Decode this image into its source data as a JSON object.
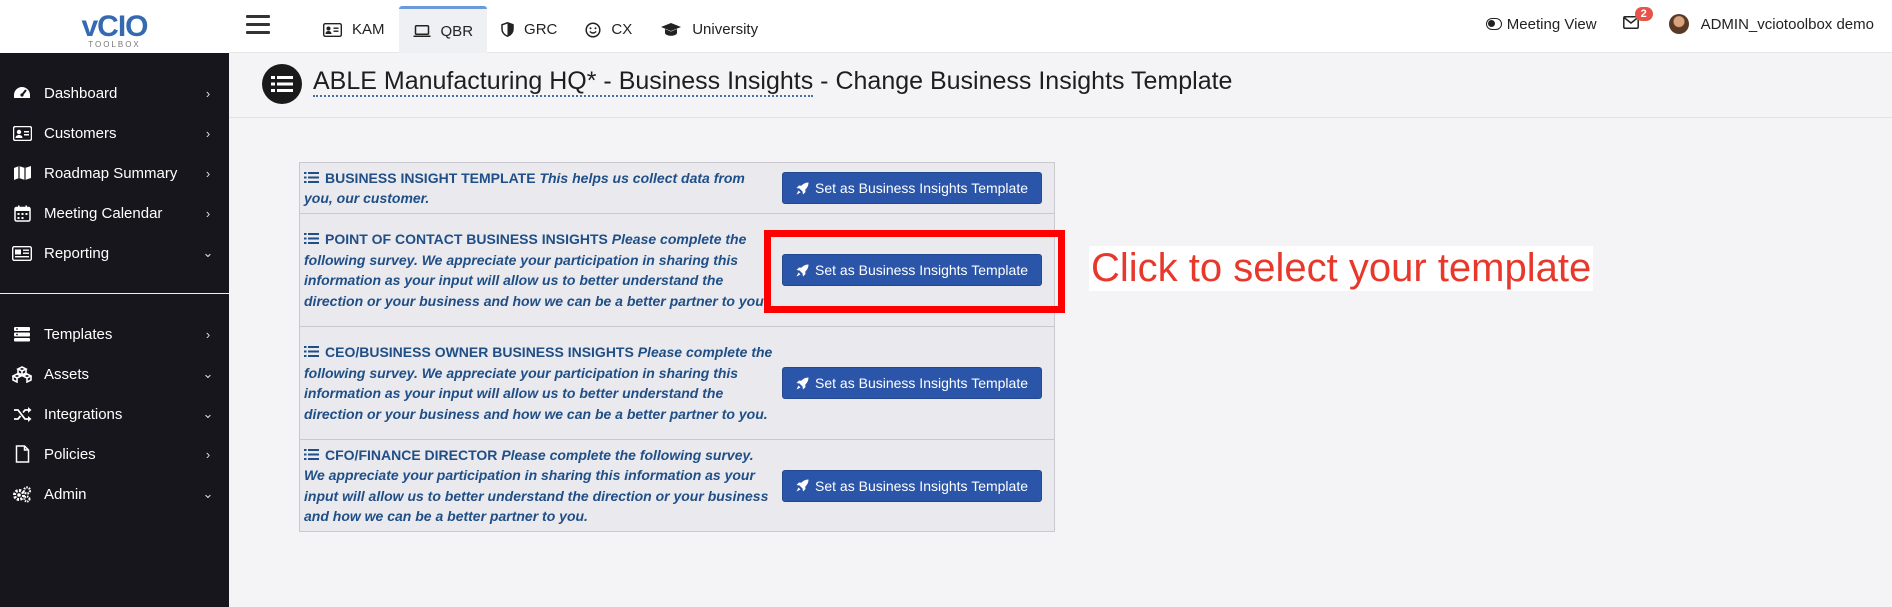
{
  "logo": {
    "main": "vCIO",
    "sub": "TOOLBOX"
  },
  "sidebar": {
    "items": [
      {
        "label": "Dashboard",
        "icon": "dashboard-icon",
        "caret": "›"
      },
      {
        "label": "Customers",
        "icon": "address-card-icon",
        "caret": "›"
      },
      {
        "label": "Roadmap Summary",
        "icon": "map-icon",
        "caret": "›"
      },
      {
        "label": "Meeting Calendar",
        "icon": "calendar-icon",
        "caret": "›"
      },
      {
        "label": "Reporting",
        "icon": "reporting-icon",
        "caret": "⌄"
      }
    ],
    "items2": [
      {
        "label": "Templates",
        "icon": "templates-icon",
        "caret": "›"
      },
      {
        "label": "Assets",
        "icon": "assets-icon",
        "caret": "⌄"
      },
      {
        "label": "Integrations",
        "icon": "shuffle-icon",
        "caret": "⌄"
      },
      {
        "label": "Policies",
        "icon": "file-icon",
        "caret": "›"
      },
      {
        "label": "Admin",
        "icon": "gears-icon",
        "caret": "⌄"
      }
    ]
  },
  "topbar": {
    "tabs": [
      {
        "label": "KAM",
        "icon": "id-card-icon",
        "active": false
      },
      {
        "label": "QBR",
        "icon": "laptop-icon",
        "active": true
      },
      {
        "label": "GRC",
        "icon": "shield-icon",
        "active": false
      },
      {
        "label": "CX",
        "icon": "smile-icon",
        "active": false
      },
      {
        "label": "University",
        "icon": "graduation-cap-icon",
        "active": false
      }
    ],
    "meeting_view": "Meeting View",
    "mail_badge": "2",
    "user_name": "ADMIN_vciotoolbox demo"
  },
  "page": {
    "title_link": "ABLE Manufacturing HQ* - Business Insights",
    "title_rest": " - Change Business Insights Template"
  },
  "templates": [
    {
      "name": "BUSINESS INSIGHT TEMPLATE",
      "description": "This helps us collect data from you, our customer.",
      "button": "Set as Business Insights Template"
    },
    {
      "name": "POINT OF CONTACT BUSINESS INSIGHTS",
      "description": "Please complete the following survey. We appreciate your participation in sharing this information as your input will allow us to better understand the direction or your business and how we can be a better partner to you.",
      "button": "Set as Business Insights Template"
    },
    {
      "name": "CEO/BUSINESS OWNER BUSINESS INSIGHTS",
      "description": "Please complete the following survey. We appreciate your participation in sharing this information as your input will allow us to better understand the direction or your business and how we can be a better partner to you.",
      "button": "Set as Business Insights Template"
    },
    {
      "name": "CFO/FINANCE DIRECTOR",
      "description": "Please complete the following survey. We appreciate your participation in sharing this information as your input will allow us to better understand the direction or your business and how we can be a better partner to you.",
      "button": "Set as Business Insights Template"
    }
  ],
  "callout": "Click to select your template",
  "colors": {
    "sidebar_bg": "#16161c",
    "button_blue": "#2a55a8",
    "text_blue": "#1f4f86",
    "highlight_red": "#ff0000",
    "callout_red": "#e8382c",
    "badge_red": "#e5534b"
  }
}
